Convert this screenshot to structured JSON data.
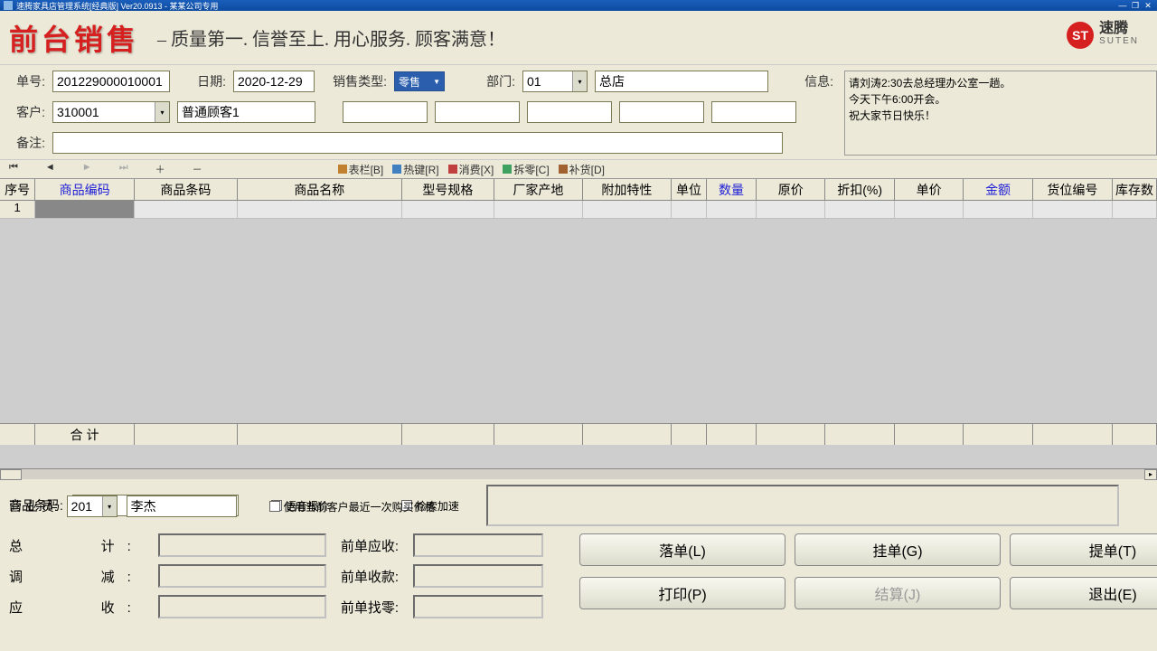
{
  "titlebar": {
    "text": "速腾家具店管理系统[经典版] Ver20.0913  -  某某公司专用"
  },
  "header": {
    "app_title": "前台销售",
    "slogan": "– 质量第一. 信誉至上. 用心服务. 顾客满意！",
    "logo_cn": "速腾",
    "logo_en": "SUTEN",
    "logo_badge": "ST"
  },
  "form": {
    "lbl_order": "单号:",
    "order_no": "201229000010001",
    "lbl_date": "日期:",
    "date": "2020-12-29",
    "lbl_sales_type": "销售类型:",
    "sales_type": "零售",
    "lbl_dept": "部门:",
    "dept_code": "01",
    "dept_name": "总店",
    "lbl_info": "信息:",
    "info_text": "请刘涛2:30去总经理办公室一趟。\n今天下午6:00开会。\n祝大家节日快乐！",
    "lbl_customer": "客户:",
    "customer_code": "310001",
    "customer_name": "普通顾客1",
    "lbl_remark": "备注:"
  },
  "toolbar": {
    "btn_table": "表栏[B]",
    "btn_hotkey": "热键[R]",
    "btn_consume": "消费[X]",
    "btn_split": "拆零[C]",
    "btn_restock": "补货[D]"
  },
  "grid": {
    "cols": [
      {
        "key": "seq",
        "label": "序号",
        "w": 40
      },
      {
        "key": "code",
        "label": "商品编码",
        "w": 112,
        "blue": true
      },
      {
        "key": "barcode",
        "label": "商品条码",
        "w": 116
      },
      {
        "key": "name",
        "label": "商品名称",
        "w": 186
      },
      {
        "key": "spec",
        "label": "型号规格",
        "w": 104
      },
      {
        "key": "origin",
        "label": "厂家产地",
        "w": 100
      },
      {
        "key": "attr",
        "label": "附加特性",
        "w": 100
      },
      {
        "key": "unit",
        "label": "单位",
        "w": 40
      },
      {
        "key": "qty",
        "label": "数量",
        "w": 56,
        "blue": true
      },
      {
        "key": "orig",
        "label": "原价",
        "w": 78
      },
      {
        "key": "disc",
        "label": "折扣(%)",
        "w": 78
      },
      {
        "key": "price",
        "label": "单价",
        "w": 78
      },
      {
        "key": "amount",
        "label": "金额",
        "w": 78,
        "blue": true
      },
      {
        "key": "loc",
        "label": "货位编号",
        "w": 90
      },
      {
        "key": "stock",
        "label": "库存数",
        "w": 50
      }
    ],
    "row1_seq": "1",
    "footer_label": "合   计"
  },
  "bottom": {
    "lbl_barcode": "商品条码:",
    "lbl_sales": "营 业 员:",
    "sales_code": "201",
    "sales_name": "李杰",
    "chk_voice": "语音报价",
    "chk_search": "检索加速",
    "chk_lastprice": "使用当前客户最近一次购买价格",
    "lbl_total": "总计:",
    "lbl_adjust": "调减:",
    "lbl_receive": "应收:",
    "lbl_prev_due": "前单应收:",
    "lbl_prev_paid": "前单收款:",
    "lbl_prev_change": "前单找零:",
    "btn_drop": "落单(L)",
    "btn_hold": "挂单(G)",
    "btn_pick": "提单(T)",
    "btn_print": "打印(P)",
    "btn_settle": "结算(J)",
    "btn_exit": "退出(E)"
  }
}
